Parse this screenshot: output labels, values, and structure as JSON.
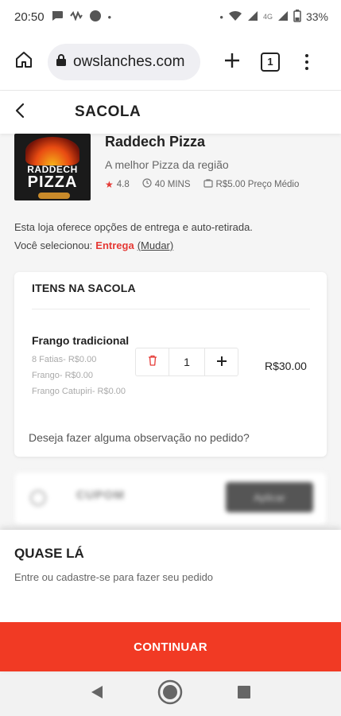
{
  "status_bar": {
    "time": "20:50",
    "network": "4G",
    "battery": "33%"
  },
  "browser": {
    "url": "owslanches.com",
    "tab_count": "1"
  },
  "header": {
    "title": "SACOLA"
  },
  "store": {
    "logo_line1": "RADDECH",
    "logo_line2": "PIZZA",
    "name": "Raddech Pizza",
    "tagline": "A melhor Pizza da região",
    "rating": "4.8",
    "time": "40 MINS",
    "avg_price": "R$5.00 Preço Médio",
    "delivery_info": "Esta loja oferece opções de entrega e auto-retirada.",
    "selected_label": "Você selecionou:",
    "selected_value": "Entrega",
    "change_label": "(Mudar)"
  },
  "cart": {
    "title": "ITENS NA SACOLA",
    "items": [
      {
        "name": "Frango tradicional",
        "options": [
          "8 Fatias- R$0.00",
          "Frango- R$0.00",
          "Frango Catupiri- R$0.00"
        ],
        "quantity": "1",
        "price": "R$30.00"
      }
    ],
    "observation_placeholder": "Deseja fazer alguma observação no pedido?"
  },
  "coupon": {
    "label": "CUPOM",
    "apply_label": "Aplicar"
  },
  "sheet": {
    "title": "QUASE LÁ",
    "subtitle": "Entre ou cadastre-se para fazer seu pedido",
    "continue_label": "CONTINUAR"
  },
  "colors": {
    "accent": "#f13a24",
    "rating_star": "#e53935"
  },
  "icons": {
    "home": "home-icon",
    "lock": "lock-icon",
    "back": "back-arrow-icon",
    "trash": "trash-icon",
    "clock": "clock-icon",
    "price": "price-tag-icon"
  }
}
